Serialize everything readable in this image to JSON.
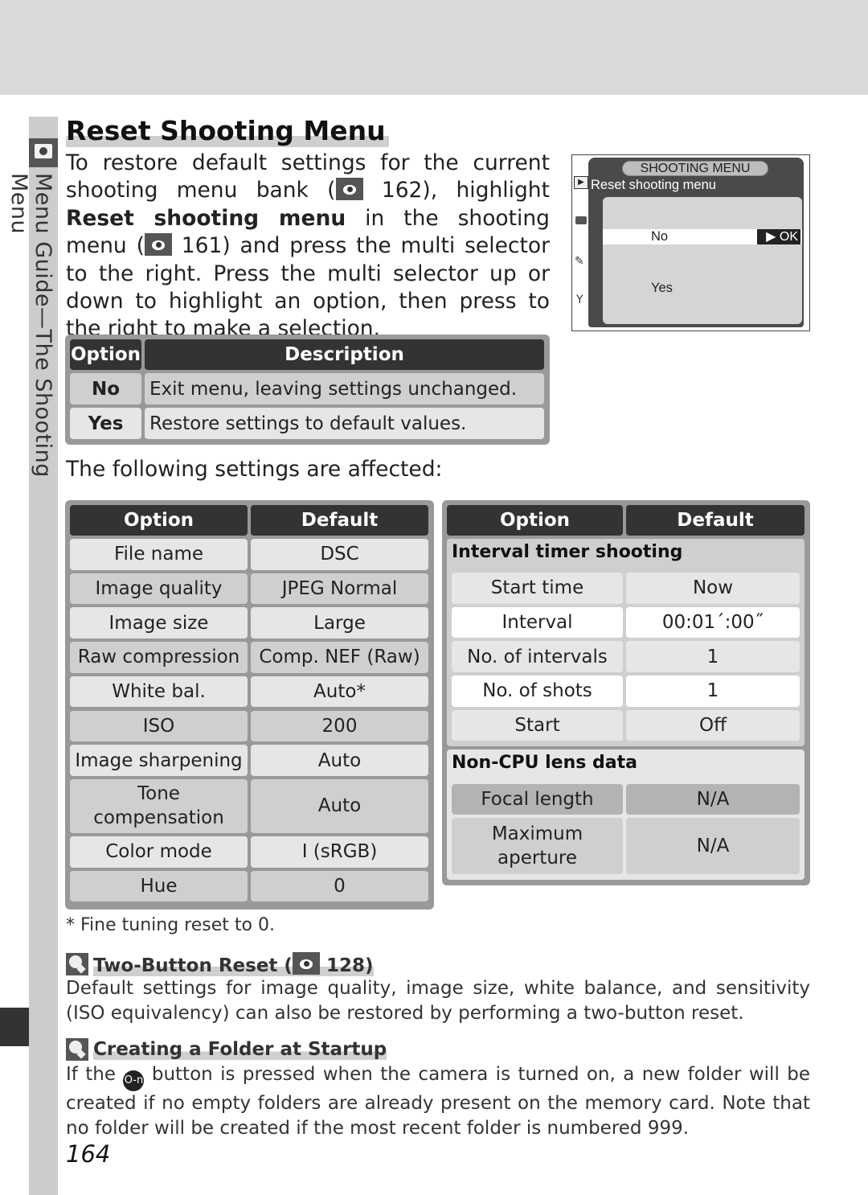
{
  "sidebar": {
    "section_label": "Menu Guide—The Shooting Menu",
    "icon": "camera-icon"
  },
  "page": {
    "title": "Reset Shooting Menu",
    "intro": {
      "p1": "To restore default settings for the current shooting menu bank (",
      "ref1": "162",
      "p2": "), highlight ",
      "bold1": "Reset shooting menu",
      "p3": " in the shooting menu (",
      "ref2": "161",
      "p4": ") and press the multi selector to the right.  Press the multi selector up or down to highlight an option, then press to the right to make a selection."
    },
    "page_number": "164"
  },
  "lcd": {
    "menu_title": "SHOOTING MENU",
    "subtitle": "Reset shooting menu",
    "options": [
      "No",
      "Yes"
    ],
    "selected": "No",
    "ok_label": "▶ OK",
    "tab_icons": [
      "playback-icon",
      "camera-icon",
      "pencil-icon",
      "wrench-icon"
    ]
  },
  "options_table": {
    "headers": [
      "Option",
      "Description"
    ],
    "rows": [
      {
        "option": "No",
        "description": "Exit menu, leaving settings unchanged."
      },
      {
        "option": "Yes",
        "description": "Restore settings to default values."
      }
    ]
  },
  "affected_label": "The following settings are affected:",
  "defaults_left": {
    "headers": [
      "Option",
      "Default"
    ],
    "rows": [
      {
        "option": "File name",
        "default": "DSC"
      },
      {
        "option": "Image quality",
        "default": "JPEG Normal"
      },
      {
        "option": "Image size",
        "default": "Large"
      },
      {
        "option": "Raw compression",
        "default": "Comp. NEF (Raw)"
      },
      {
        "option": "White bal.",
        "default": "Auto*"
      },
      {
        "option": "ISO",
        "default": "200"
      },
      {
        "option": "Image sharpening",
        "default": "Auto"
      },
      {
        "option": "Tone compensation",
        "default": "Auto"
      },
      {
        "option": "Color mode",
        "default": "I (sRGB)"
      },
      {
        "option": "Hue",
        "default": "0"
      }
    ]
  },
  "defaults_right": {
    "headers": [
      "Option",
      "Default"
    ],
    "sections": [
      {
        "title": "Interval timer shooting",
        "rows": [
          {
            "option": "Start time",
            "default": "Now"
          },
          {
            "option": "Interval",
            "default": "00:01´:00˝"
          },
          {
            "option": "No. of intervals",
            "default": "1"
          },
          {
            "option": "No. of shots",
            "default": "1"
          },
          {
            "option": "Start",
            "default": "Off"
          }
        ]
      },
      {
        "title": "Non-CPU lens data",
        "rows": [
          {
            "option": "Focal length",
            "default": "N/A"
          },
          {
            "option": "Maximum aperture",
            "default": "N/A"
          }
        ]
      }
    ]
  },
  "footnote": "* Fine tuning reset to 0.",
  "tips": [
    {
      "title": "Two-Button Reset (",
      "ref": "128",
      "title_end": ")",
      "body": "Default settings for image quality, image size, white balance, and sensitivity (ISO equivalency) can also be restored by performing a two-button reset."
    },
    {
      "title": "Creating a Folder at Startup",
      "body_pre": "If the ",
      "key_icon": "O-n",
      "body_post": " button is pressed when the camera is turned on, a new folder will be created if no empty folders are already present on the memory card.  Note that no folder will be created if the most recent folder is numbered 999."
    }
  ]
}
